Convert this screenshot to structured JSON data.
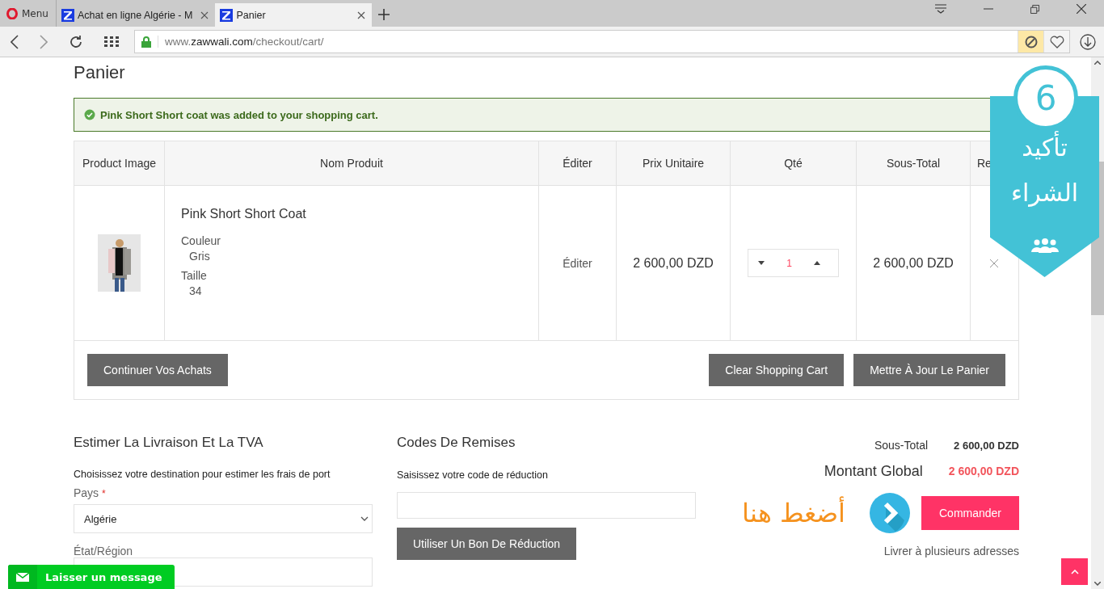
{
  "browser": {
    "menu": "Menu",
    "tabs": [
      {
        "label": "Achat en ligne Algérie - M",
        "selected": false
      },
      {
        "label": "Panier",
        "selected": true
      }
    ],
    "url": {
      "prefix": "www.",
      "host": "zawwali.com",
      "path": "/checkout/cart/"
    }
  },
  "title": "Panier",
  "notice": "Pink Short Short coat was added to your shopping cart.",
  "table": {
    "columns": [
      "Product Image",
      "Nom Produit",
      "Éditer",
      "Prix Unitaire",
      "Qté",
      "Sous-Total",
      "Re"
    ],
    "rows": [
      {
        "name": "Pink Short Short Coat",
        "options": [
          {
            "label": "Couleur",
            "value": "Gris"
          },
          {
            "label": "Taille",
            "value": "34"
          }
        ],
        "edit": "Éditer",
        "price": "2 600,00 DZD",
        "qty": "1",
        "subtotal": "2 600,00 DZD"
      }
    ]
  },
  "cart_actions": {
    "continue": "Continuer Vos Achats",
    "clear": "Clear Shopping Cart",
    "update": "Mettre À Jour Le Panier"
  },
  "shipping": {
    "heading": "Estimer La Livraison Et La TVA",
    "intro": "Choisissez votre destination pour estimer les frais de port",
    "country_label": "Pays",
    "required_mark": "*",
    "country_value": "Algérie",
    "region_label": "État/Région"
  },
  "discount": {
    "heading": "Codes De Remises",
    "intro": "Saisissez votre code de réduction",
    "button": "Utiliser Un Bon De Réduction"
  },
  "totals": [
    {
      "label": "Sous-Total",
      "value": "2 600,00 DZD",
      "kind": "sub"
    },
    {
      "label": "Montant Global",
      "value": "2 600,00 DZD",
      "kind": "grand"
    }
  ],
  "checkout": {
    "hint": "أضغط هنا",
    "button": "Commander",
    "multi": "Livrer à plusieurs adresses"
  },
  "promo": {
    "number": "6",
    "line1": "تأكيد",
    "line2": "الشراء"
  },
  "chat": {
    "label": "Laisser un message"
  }
}
